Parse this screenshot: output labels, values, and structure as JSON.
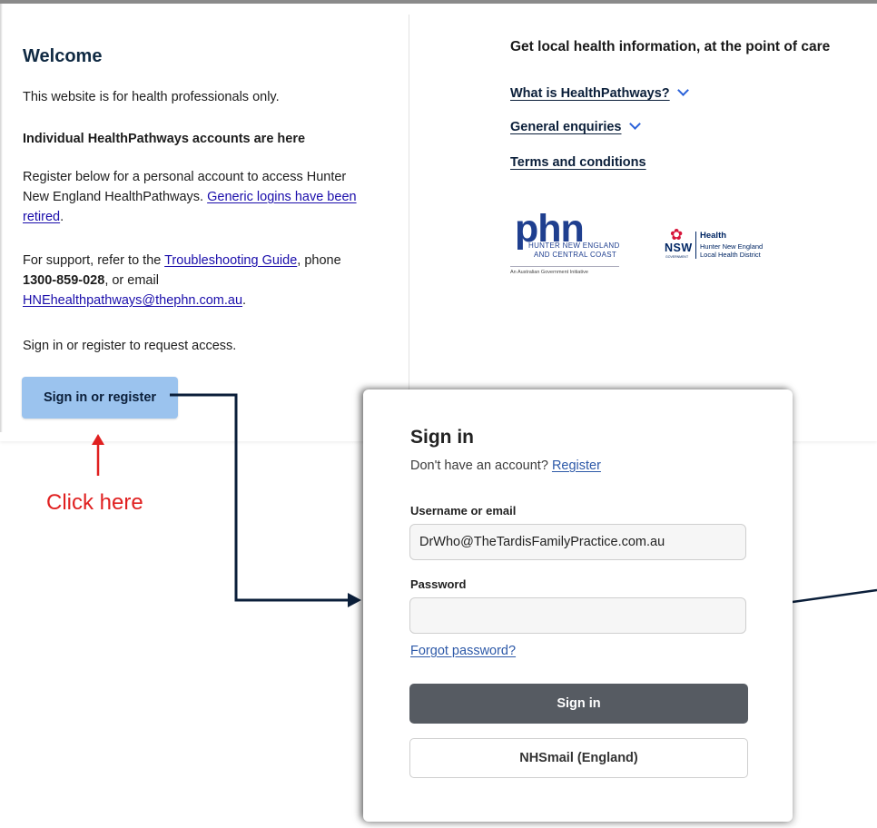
{
  "welcome": {
    "title": "Welcome",
    "intro": "This website is for health professionals only.",
    "accounts_heading": "Individual HealthPathways accounts are here",
    "register_text_1": "Register below for a personal account to access Hunter New England HealthPathways.",
    "generic_logins_link": "Generic logins have been retired",
    "period": ".",
    "support_text_1": "For support, refer to the",
    "troubleshooting_link": "Troubleshooting Guide",
    "support_text_2": ", phone",
    "phone": "1300-859-028",
    "support_text_3": ", or email",
    "email_link": "HNEhealthpathways@thephn.com.au",
    "sign_in_prompt": "Sign in or register to request access.",
    "sign_in_register_button": "Sign in or register"
  },
  "info": {
    "title": "Get local health information, at the point of care",
    "links": [
      {
        "label": "What is HealthPathways?",
        "has_chevron": true
      },
      {
        "label": "General enquiries",
        "has_chevron": true
      },
      {
        "label": "Terms and conditions",
        "has_chevron": false
      }
    ]
  },
  "logos": {
    "phn": {
      "main": "phn",
      "line1": "HUNTER NEW ENGLAND",
      "line2": "AND CENTRAL COAST",
      "initiative": "An Australian Government Initiative",
      "color": "#1f3f8f"
    },
    "nsw": {
      "word": "NSW",
      "gov": "GOVERNMENT",
      "health": "Health",
      "line1": "Hunter New England",
      "line2": "Local Health District",
      "flower_color": "#d7153a",
      "color": "#002664"
    }
  },
  "annotation": {
    "text": "Click here",
    "color": "#e02020",
    "connector_color": "#0b1f3a"
  },
  "signin": {
    "title": "Sign in",
    "no_account": "Don't have an account?",
    "register_link": "Register",
    "username_label": "Username or email",
    "username_value": "DrWho@TheTardisFamilyPractice.com.au",
    "password_label": "Password",
    "password_value": "",
    "forgot_link": "Forgot password?",
    "sign_in_button": "Sign in",
    "nhsmail_button": "NHSmail (England)"
  },
  "colors": {
    "accent_button": "#9bc3ee",
    "dark_button": "#565b62",
    "heading": "#102a43"
  }
}
